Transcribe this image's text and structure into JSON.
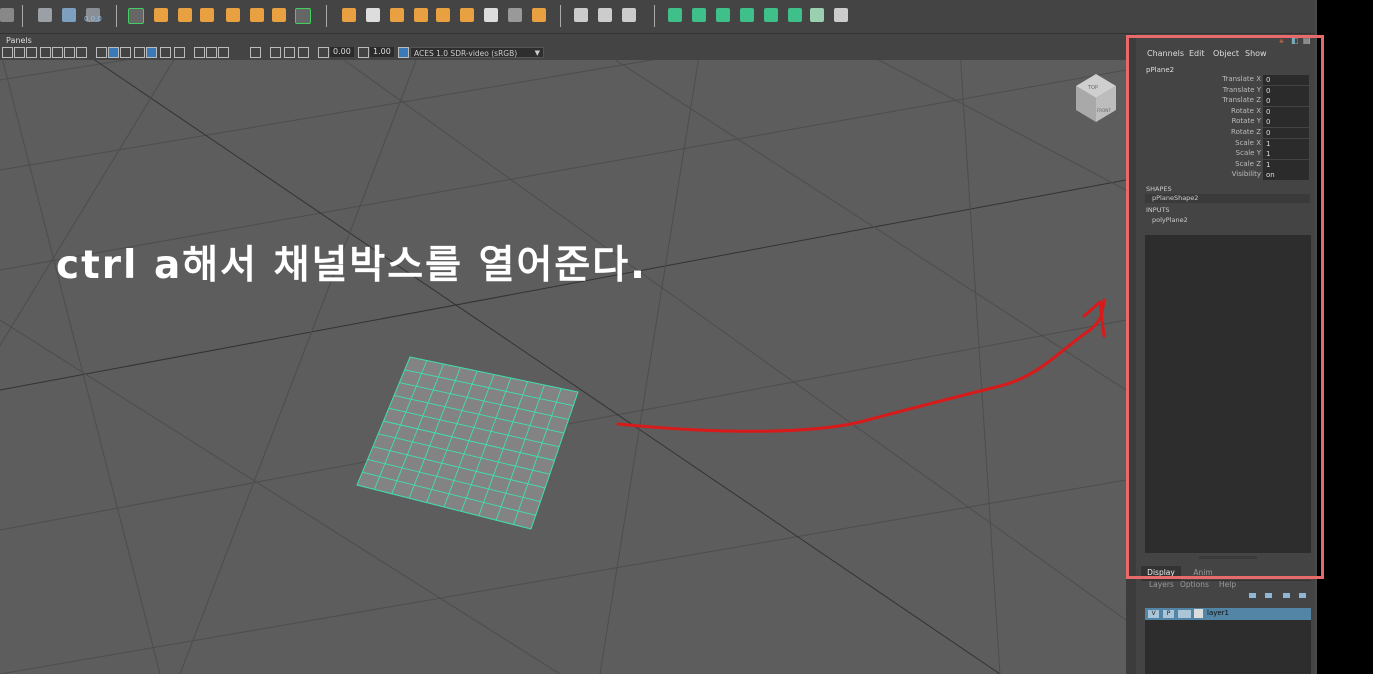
{
  "panels_menu": {
    "label": "Panels"
  },
  "viewport_toolbar": {
    "exposure_value": "0.00",
    "gamma_value": "1.00",
    "color_space": "ACES 1.0 SDR-video (sRGB)"
  },
  "view_cube": {
    "top_label": "TOP",
    "front_label": "FRONT"
  },
  "toolbar": {
    "origin_readout": "0,0,0"
  },
  "annotation": {
    "text": "ctrl a해서 채널박스를 열어준다."
  },
  "channel_box": {
    "menu": [
      "Channels",
      "Edit",
      "Object",
      "Show"
    ],
    "object_name": "pPlane2",
    "attributes": [
      {
        "label": "Translate X",
        "value": "0"
      },
      {
        "label": "Translate Y",
        "value": "0"
      },
      {
        "label": "Translate Z",
        "value": "0"
      },
      {
        "label": "Rotate X",
        "value": "0"
      },
      {
        "label": "Rotate Y",
        "value": "0"
      },
      {
        "label": "Rotate Z",
        "value": "0"
      },
      {
        "label": "Scale X",
        "value": "1"
      },
      {
        "label": "Scale Y",
        "value": "1"
      },
      {
        "label": "Scale Z",
        "value": "1"
      },
      {
        "label": "Visibility",
        "value": "on"
      }
    ],
    "shapes_header": "SHAPES",
    "shape_item": "pPlaneShape2",
    "inputs_header": "INPUTS",
    "input_item": "polyPlane2"
  },
  "layer_editor": {
    "tabs": [
      "Display",
      "Anim"
    ],
    "menu": [
      "Layers",
      "Options",
      "Help"
    ],
    "layer": {
      "v": "V",
      "p": "P",
      "name": "layer1"
    }
  },
  "colors": {
    "highlight": "#e86a6a",
    "annotation_arrow": "#d81a1a",
    "plane_wire": "#3fe0b0",
    "layer_selected": "#5285a6"
  }
}
